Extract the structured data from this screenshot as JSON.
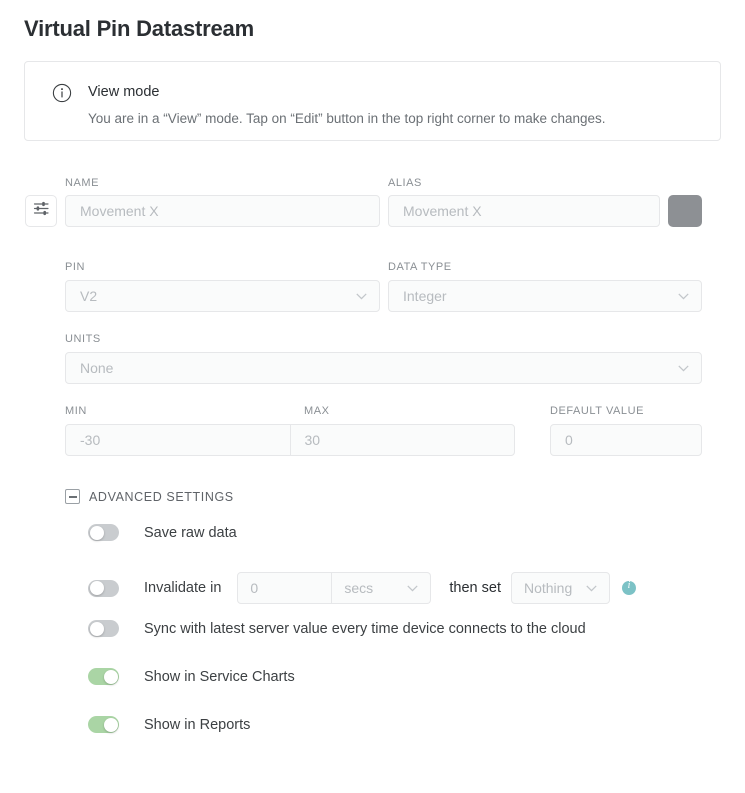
{
  "page_title": "Virtual Pin Datastream",
  "banner": {
    "icon": "info-circle-icon",
    "title": "View mode",
    "text": "You are in a “View” mode. Tap on “Edit” button in the top right corner to make changes."
  },
  "form": {
    "sliders_icon": "sliders-icon",
    "name": {
      "label": "NAME",
      "value": "Movement X",
      "placeholder": "Movement X"
    },
    "alias": {
      "label": "ALIAS",
      "value": "Movement X",
      "placeholder": "Movement X"
    },
    "color_swatch": {
      "name": "color-swatch",
      "color": "#8d9094"
    },
    "pin": {
      "label": "PIN",
      "value": "V2"
    },
    "data_type": {
      "label": "DATA TYPE",
      "value": "Integer"
    },
    "units": {
      "label": "UNITS",
      "value": "None"
    },
    "min": {
      "label": "MIN",
      "value": "-30"
    },
    "max": {
      "label": "MAX",
      "value": "30"
    },
    "default_value": {
      "label": "DEFAULT VALUE",
      "value": "0"
    }
  },
  "advanced": {
    "header": "ADVANCED SETTINGS",
    "collapse_icon": "minus-box-icon",
    "save_raw_data": {
      "label": "Save raw data",
      "state": "off"
    },
    "invalidate": {
      "label": "Invalidate in",
      "state": "off",
      "amount": "0",
      "unit": "secs",
      "then_set_label": "then set",
      "then_set_value": "Nothing",
      "info_icon": "info-icon"
    },
    "sync_latest": {
      "label": "Sync with latest server value every time device connects to the cloud",
      "state": "off"
    },
    "show_service_charts": {
      "label": "Show in Service Charts",
      "state": "on"
    },
    "show_reports": {
      "label": "Show in Reports",
      "state": "on"
    }
  },
  "colors": {
    "toggle_on": "#aad5a5",
    "toggle_off": "#c9cccf",
    "info_teal": "#7cc2c6"
  }
}
